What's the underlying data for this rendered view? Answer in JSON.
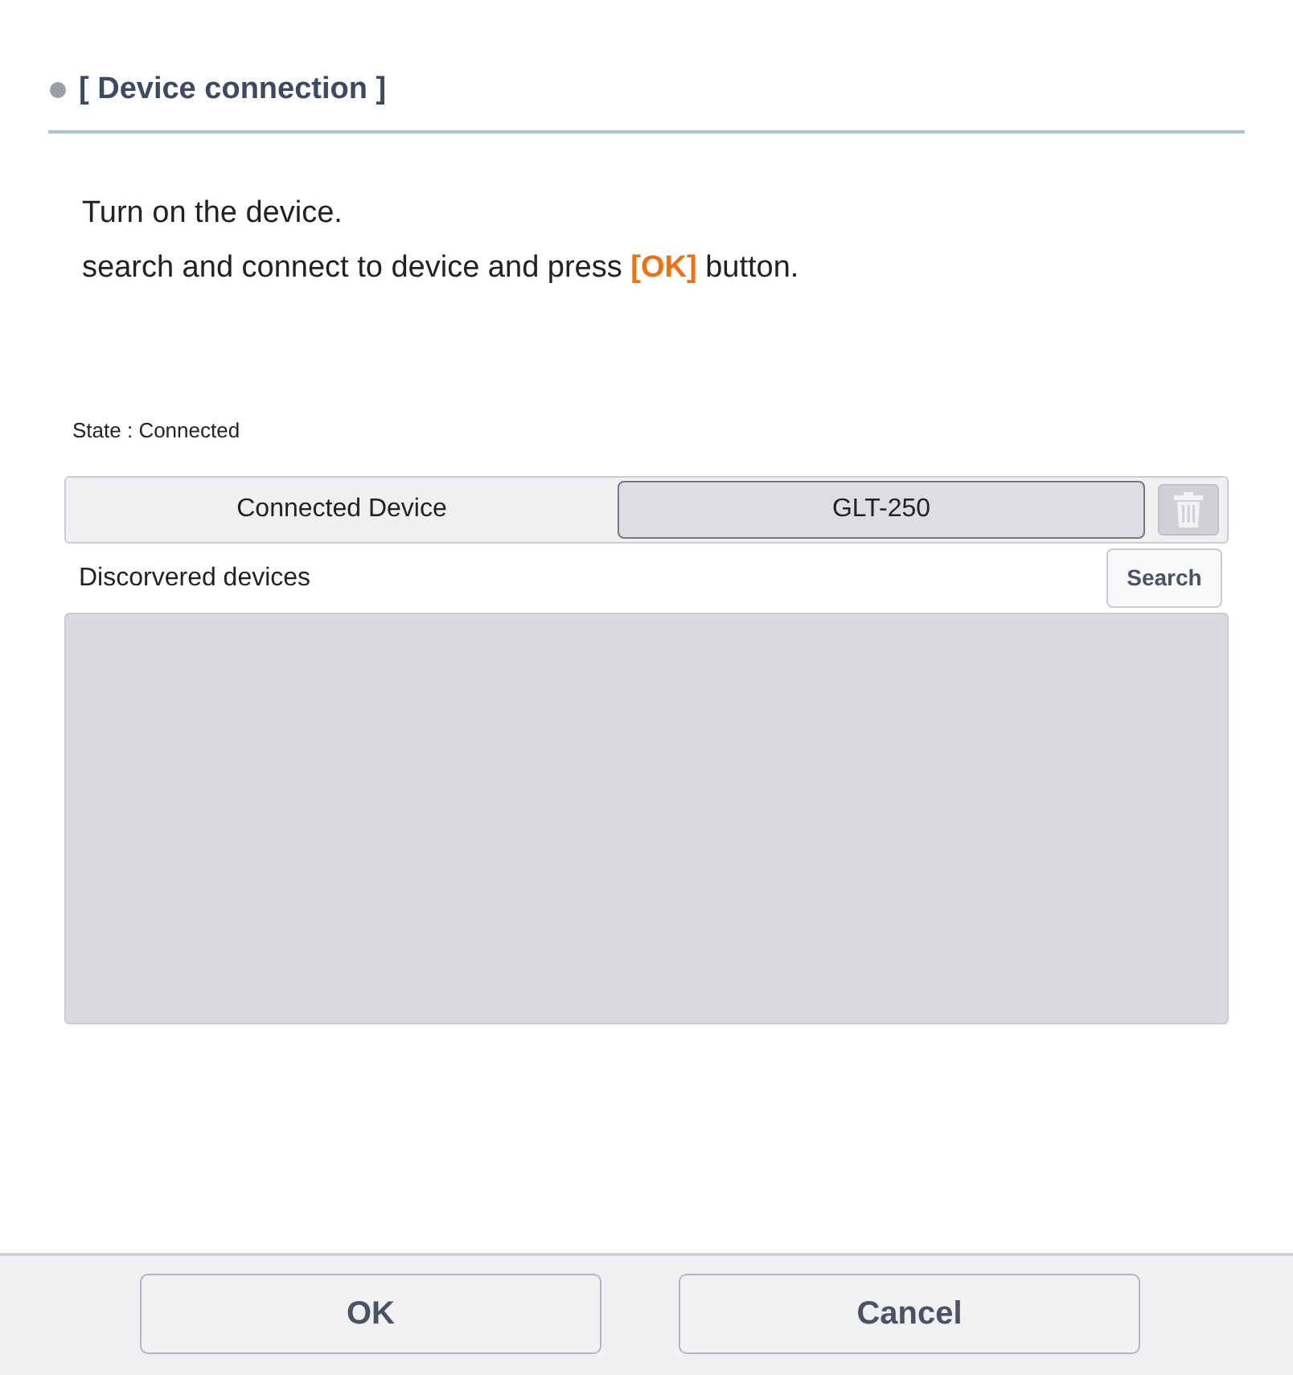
{
  "section_title": "[ Device connection ]",
  "instructions": [
    "Turn on the device.",
    "search and connect to device and press **[OK]** button."
  ],
  "state_label": "State : Connected",
  "connected_device": {
    "label": "Connected Device",
    "value": "GLT-250"
  },
  "discovered": {
    "label": "Discorvered devices",
    "search_button": "Search"
  },
  "buttons": [
    "OK",
    "Cancel"
  ]
}
